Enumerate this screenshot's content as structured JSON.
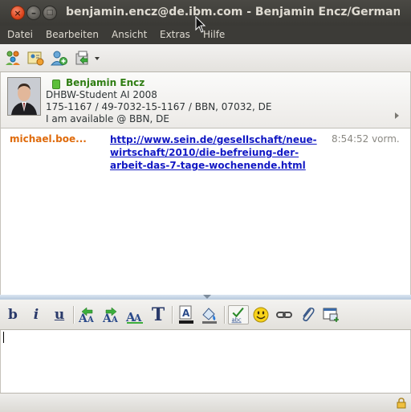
{
  "window": {
    "title": "benjamin.encz@de.ibm.com - Benjamin Encz/Germany/IBM"
  },
  "menu": {
    "items": [
      {
        "label": "Datei"
      },
      {
        "label": "Bearbeiten"
      },
      {
        "label": "Ansicht"
      },
      {
        "label": "Extras"
      },
      {
        "label": "Hilfe"
      }
    ]
  },
  "contact": {
    "name": "Benjamin Encz",
    "status": "available",
    "title": "DHBW-Student AI 2008",
    "phone": "175-1167 / 49-7032-15-1167 / BBN, 07032, DE",
    "status_message": "I am available @ BBN, DE"
  },
  "chat": {
    "messages": [
      {
        "sender": "michael.boe...",
        "text": "http://www.sein.de/gesellschaft/neue-wirtschaft/2010/die-befreiung-der-arbeit-das-7-tage-wochenende.html",
        "time": "8:54:52 vorm."
      }
    ]
  },
  "format_toolbar": {
    "icons": [
      "bold-icon",
      "italic-icon",
      "underline-icon",
      "grow-font-icon",
      "shrink-font-icon",
      "font-icon",
      "text-style-icon",
      "text-color-icon",
      "highlight-color-icon",
      "spell-check-icon",
      "emoticon-icon",
      "link-icon",
      "attachment-icon",
      "screen-capture-icon"
    ],
    "labels": {
      "bold": "b",
      "italic": "i",
      "underline": "u",
      "text_style": "T"
    }
  },
  "colors": {
    "titlebar": "#3c3b37",
    "contact_name": "#2e7d12",
    "sender": "#df6b0c",
    "link": "#1118c4"
  }
}
